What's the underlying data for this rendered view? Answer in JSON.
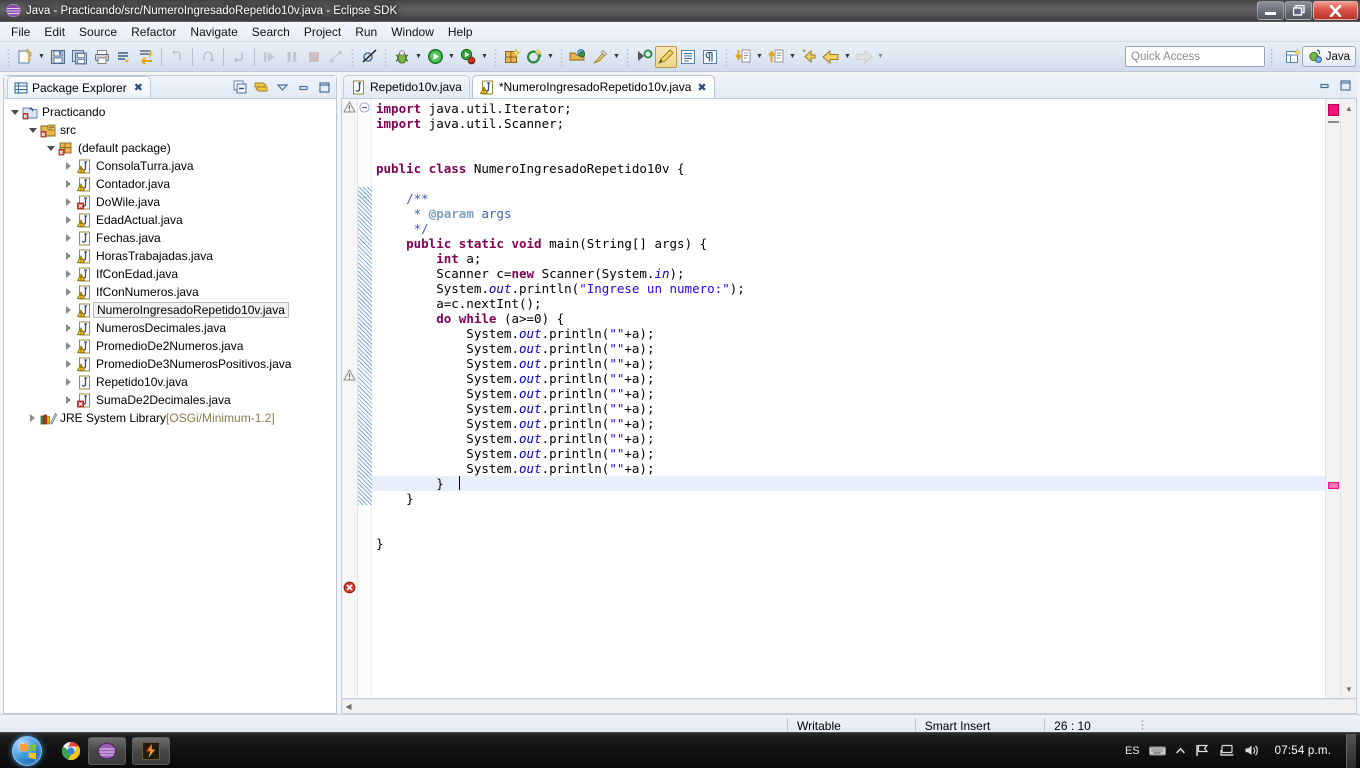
{
  "window": {
    "title": "Java - Practicando/src/NumeroIngresadoRepetido10v.java - Eclipse SDK",
    "minimize_label": "–",
    "restore_label": "❐",
    "close_label": "✕"
  },
  "menubar": {
    "items": [
      "File",
      "Edit",
      "Source",
      "Refactor",
      "Navigate",
      "Search",
      "Project",
      "Run",
      "Window",
      "Help"
    ]
  },
  "toolbar": {
    "quick_access_placeholder": "Quick Access",
    "perspective_label": "Java",
    "buttons": [
      "new-wizard-icon",
      "save-icon",
      "save-all-icon",
      "print-icon",
      "build-all-icon",
      "export-icon",
      "undo-icon",
      "redo-icon",
      "step-return-icon",
      "resume-icon",
      "suspend-icon",
      "terminate-icon",
      "disconnect-icon",
      "skip-breakpoints-icon",
      "debug-icon",
      "run-icon",
      "run-history-icon",
      "external-tools-icon",
      "new-java-project-icon",
      "new-class-icon",
      "open-type-icon",
      "search-icon",
      "toggle-mark-occurrences-icon",
      "show-whitespace-icon",
      "pilcrow-icon",
      "next-annotation-icon",
      "previous-annotation-icon",
      "last-edit-icon",
      "back-icon",
      "forward-icon",
      "open-perspective-icon"
    ]
  },
  "package_explorer": {
    "tab_label": "Package Explorer",
    "tab_close": "✖",
    "toolbar": [
      "collapse-all-icon",
      "link-with-editor-icon",
      "view-menu-icon",
      "minimize-icon",
      "maximize-icon"
    ],
    "tree": [
      {
        "label": "Practicando",
        "depth": 0,
        "twisty": "open",
        "icon": "java-project-icon",
        "selected": false
      },
      {
        "label": "src",
        "depth": 1,
        "twisty": "open",
        "icon": "source-folder-icon",
        "selected": false
      },
      {
        "label": "(default package)",
        "depth": 2,
        "twisty": "open",
        "icon": "package-icon",
        "selected": false
      },
      {
        "label": "ConsolaTurra.java",
        "depth": 3,
        "twisty": "closed",
        "icon": "java-file-warning-icon",
        "selected": false
      },
      {
        "label": "Contador.java",
        "depth": 3,
        "twisty": "closed",
        "icon": "java-file-warning-icon",
        "selected": false
      },
      {
        "label": "DoWile.java",
        "depth": 3,
        "twisty": "closed",
        "icon": "java-file-error-icon",
        "selected": false
      },
      {
        "label": "EdadActual.java",
        "depth": 3,
        "twisty": "closed",
        "icon": "java-file-warning-icon",
        "selected": false
      },
      {
        "label": "Fechas.java",
        "depth": 3,
        "twisty": "closed",
        "icon": "java-file-icon",
        "selected": false
      },
      {
        "label": "HorasTrabajadas.java",
        "depth": 3,
        "twisty": "closed",
        "icon": "java-file-warning-icon",
        "selected": false
      },
      {
        "label": "IfConEdad.java",
        "depth": 3,
        "twisty": "closed",
        "icon": "java-file-warning-icon",
        "selected": false
      },
      {
        "label": "IfConNumeros.java",
        "depth": 3,
        "twisty": "closed",
        "icon": "java-file-warning-icon",
        "selected": false
      },
      {
        "label": "NumeroIngresadoRepetido10v.java",
        "depth": 3,
        "twisty": "closed",
        "icon": "java-file-warning-icon",
        "selected": true
      },
      {
        "label": "NumerosDecimales.java",
        "depth": 3,
        "twisty": "closed",
        "icon": "java-file-warning-icon",
        "selected": false
      },
      {
        "label": "PromedioDe2Numeros.java",
        "depth": 3,
        "twisty": "closed",
        "icon": "java-file-warning-icon",
        "selected": false
      },
      {
        "label": "PromedioDe3NumerosPositivos.java",
        "depth": 3,
        "twisty": "closed",
        "icon": "java-file-warning-icon",
        "selected": false
      },
      {
        "label": "Repetido10v.java",
        "depth": 3,
        "twisty": "closed",
        "icon": "java-file-icon",
        "selected": false
      },
      {
        "label": "SumaDe2Decimales.java",
        "depth": 3,
        "twisty": "closed",
        "icon": "java-file-error-icon",
        "selected": false
      },
      {
        "label": "JRE System Library",
        "suffix": " [OSGi/Minimum-1.2]",
        "depth": 1,
        "twisty": "closed",
        "icon": "jre-library-icon",
        "selected": false
      }
    ]
  },
  "editor": {
    "tabs": [
      {
        "label": "Repetido10v.java",
        "active": false,
        "dirty": false,
        "icon": "java-file-icon",
        "close": ""
      },
      {
        "label": "*NumeroIngresadoRepetido10v.java",
        "active": true,
        "dirty": true,
        "icon": "java-file-warning-icon",
        "close": "✖"
      }
    ],
    "toolbar": [
      "minimize-icon",
      "maximize-icon"
    ],
    "code_lines": [
      {
        "n": 1,
        "tokens": [
          {
            "t": "import ",
            "c": "kw"
          },
          {
            "t": "java.util.Iterator;",
            "c": "pln"
          }
        ]
      },
      {
        "n": 2,
        "tokens": [
          {
            "t": "import ",
            "c": "kw"
          },
          {
            "t": "java.util.Scanner;",
            "c": "pln"
          }
        ]
      },
      {
        "n": 3,
        "tokens": []
      },
      {
        "n": 4,
        "tokens": []
      },
      {
        "n": 5,
        "tokens": [
          {
            "t": "public class ",
            "c": "kw"
          },
          {
            "t": "NumeroIngresadoRepetido10v {",
            "c": "pln"
          }
        ]
      },
      {
        "n": 6,
        "tokens": []
      },
      {
        "n": 7,
        "tokens": [
          {
            "t": "    /**",
            "c": "jdoc"
          }
        ]
      },
      {
        "n": 8,
        "tokens": [
          {
            "t": "     * ",
            "c": "jdoc"
          },
          {
            "t": "@param",
            "c": "jdoctag"
          },
          {
            "t": " args",
            "c": "jdoc"
          }
        ]
      },
      {
        "n": 9,
        "tokens": [
          {
            "t": "     */",
            "c": "jdoc"
          }
        ]
      },
      {
        "n": 10,
        "tokens": [
          {
            "t": "    ",
            "c": "pln"
          },
          {
            "t": "public static void ",
            "c": "kw"
          },
          {
            "t": "main(String[] args) {",
            "c": "pln"
          }
        ]
      },
      {
        "n": 11,
        "tokens": [
          {
            "t": "        ",
            "c": "pln"
          },
          {
            "t": "int ",
            "c": "kw"
          },
          {
            "t": "a;",
            "c": "pln"
          }
        ]
      },
      {
        "n": 12,
        "tokens": [
          {
            "t": "        Scanner c=",
            "c": "pln"
          },
          {
            "t": "new ",
            "c": "kw"
          },
          {
            "t": "Scanner(System.",
            "c": "pln"
          },
          {
            "t": "in",
            "c": "stat"
          },
          {
            "t": ");",
            "c": "pln"
          }
        ]
      },
      {
        "n": 13,
        "tokens": [
          {
            "t": "        System.",
            "c": "pln"
          },
          {
            "t": "out",
            "c": "stat"
          },
          {
            "t": ".println(",
            "c": "pln"
          },
          {
            "t": "\"Ingrese un numero:\"",
            "c": "str"
          },
          {
            "t": ");",
            "c": "pln"
          }
        ]
      },
      {
        "n": 14,
        "tokens": [
          {
            "t": "        a=c.nextInt();",
            "c": "pln"
          }
        ]
      },
      {
        "n": 15,
        "tokens": [
          {
            "t": "        ",
            "c": "pln"
          },
          {
            "t": "do while ",
            "c": "kw"
          },
          {
            "t": "(a>=0) {",
            "c": "pln"
          }
        ]
      },
      {
        "n": 16,
        "tokens": [
          {
            "t": "            System.",
            "c": "pln"
          },
          {
            "t": "out",
            "c": "stat"
          },
          {
            "t": ".println(",
            "c": "pln"
          },
          {
            "t": "\"\"",
            "c": "str"
          },
          {
            "t": "+a);",
            "c": "pln"
          }
        ]
      },
      {
        "n": 17,
        "tokens": [
          {
            "t": "            System.",
            "c": "pln"
          },
          {
            "t": "out",
            "c": "stat"
          },
          {
            "t": ".println(",
            "c": "pln"
          },
          {
            "t": "\"\"",
            "c": "str"
          },
          {
            "t": "+a);",
            "c": "pln"
          }
        ]
      },
      {
        "n": 18,
        "tokens": [
          {
            "t": "            System.",
            "c": "pln"
          },
          {
            "t": "out",
            "c": "stat"
          },
          {
            "t": ".println(",
            "c": "pln"
          },
          {
            "t": "\"\"",
            "c": "str"
          },
          {
            "t": "+a);",
            "c": "pln"
          }
        ]
      },
      {
        "n": 19,
        "tokens": [
          {
            "t": "            System.",
            "c": "pln"
          },
          {
            "t": "out",
            "c": "stat"
          },
          {
            "t": ".println(",
            "c": "pln"
          },
          {
            "t": "\"\"",
            "c": "str"
          },
          {
            "t": "+a);",
            "c": "pln"
          }
        ]
      },
      {
        "n": 20,
        "tokens": [
          {
            "t": "            System.",
            "c": "pln"
          },
          {
            "t": "out",
            "c": "stat"
          },
          {
            "t": ".println(",
            "c": "pln"
          },
          {
            "t": "\"\"",
            "c": "str"
          },
          {
            "t": "+a);",
            "c": "pln"
          }
        ]
      },
      {
        "n": 21,
        "tokens": [
          {
            "t": "            System.",
            "c": "pln"
          },
          {
            "t": "out",
            "c": "stat"
          },
          {
            "t": ".println(",
            "c": "pln"
          },
          {
            "t": "\"\"",
            "c": "str"
          },
          {
            "t": "+a);",
            "c": "pln"
          }
        ]
      },
      {
        "n": 22,
        "tokens": [
          {
            "t": "            System.",
            "c": "pln"
          },
          {
            "t": "out",
            "c": "stat"
          },
          {
            "t": ".println(",
            "c": "pln"
          },
          {
            "t": "\"\"",
            "c": "str"
          },
          {
            "t": "+a);",
            "c": "pln"
          }
        ]
      },
      {
        "n": 23,
        "tokens": [
          {
            "t": "            System.",
            "c": "pln"
          },
          {
            "t": "out",
            "c": "stat"
          },
          {
            "t": ".println(",
            "c": "pln"
          },
          {
            "t": "\"\"",
            "c": "str"
          },
          {
            "t": "+a);",
            "c": "pln"
          }
        ]
      },
      {
        "n": 24,
        "tokens": [
          {
            "t": "            System.",
            "c": "pln"
          },
          {
            "t": "out",
            "c": "stat"
          },
          {
            "t": ".println(",
            "c": "pln"
          },
          {
            "t": "\"\"",
            "c": "str"
          },
          {
            "t": "+a);",
            "c": "pln"
          }
        ]
      },
      {
        "n": 25,
        "tokens": [
          {
            "t": "            System.",
            "c": "pln"
          },
          {
            "t": "out",
            "c": "stat"
          },
          {
            "t": ".println(",
            "c": "pln"
          },
          {
            "t": "\"\"",
            "c": "str"
          },
          {
            "t": "+a);",
            "c": "pln"
          }
        ]
      },
      {
        "n": 26,
        "tokens": [
          {
            "t": "        }",
            "c": "pln"
          }
        ],
        "highlight": true,
        "marker": "error"
      },
      {
        "n": 27,
        "tokens": [
          {
            "t": "    }",
            "c": "pln"
          }
        ]
      },
      {
        "n": 28,
        "tokens": []
      },
      {
        "n": 29,
        "tokens": []
      },
      {
        "n": 30,
        "tokens": [
          {
            "t": "}",
            "c": "pln"
          }
        ]
      }
    ]
  },
  "statusbar": {
    "writable": "Writable",
    "insert_mode": "Smart Insert",
    "position": "26 : 10"
  },
  "taskbar": {
    "start_label": "start-orb",
    "quicklaunch": [
      "chrome-icon",
      "eclipse-icon"
    ],
    "tasks": [
      "eclipse-task-icon",
      "winrar-task-icon"
    ],
    "tray": {
      "language": "ES",
      "icons": [
        "keyboard-icon",
        "show-hidden-icon",
        "flag-icon",
        "network-icon",
        "volume-icon"
      ],
      "clock": "07:54 p.m."
    }
  },
  "colors": {
    "keyword": "#7f0055",
    "string": "#2a00ff",
    "javadoc": "#3f5fbf",
    "static_field": "#0000c0",
    "highlight_line": "#e8eefc",
    "accent": "#f0147a"
  }
}
